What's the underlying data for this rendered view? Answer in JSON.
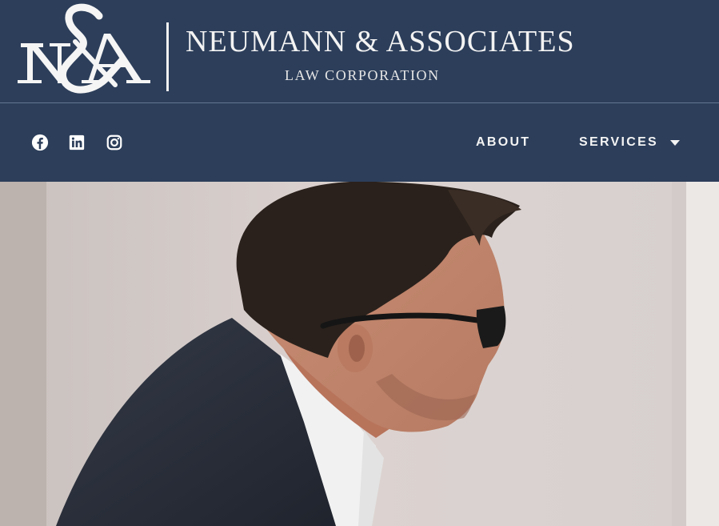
{
  "brand": {
    "monogram": "N&A",
    "name": "NEUMANN & ASSOCIATES",
    "subtitle": "LAW CORPORATION"
  },
  "social": [
    {
      "icon": "facebook-icon"
    },
    {
      "icon": "linkedin-icon"
    },
    {
      "icon": "instagram-icon"
    }
  ],
  "nav": {
    "about": "ABOUT",
    "services": "SERVICES"
  },
  "colors": {
    "header_bg": "#2c3e5a",
    "text": "#f4f4f4"
  }
}
